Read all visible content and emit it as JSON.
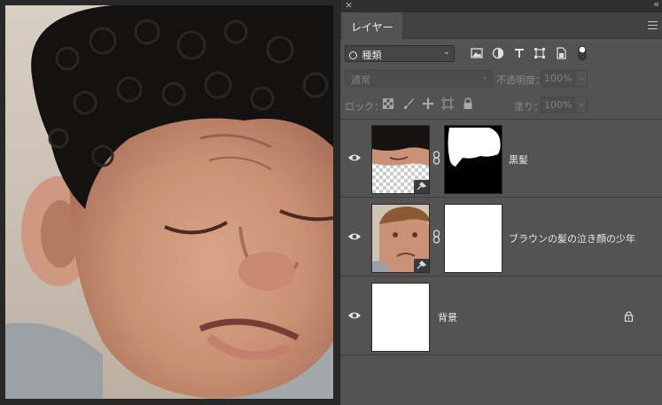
{
  "window": {
    "close_glyph": "×",
    "collapse_glyph": "‹‹"
  },
  "panel": {
    "tab_label": "レイヤー",
    "filter": {
      "kind_label": "種類",
      "caret": "⌄"
    },
    "blend_mode": {
      "value": "通常",
      "opacity_label": "不透明度：",
      "opacity_value": "100%"
    },
    "lock": {
      "label": "ロック：",
      "fill_label": "塗り：",
      "fill_value": "100%"
    }
  },
  "layers": [
    {
      "name": "黒髪",
      "visible": true,
      "smart_object": true,
      "has_mask": true,
      "mask_icon": "chain-link-icon"
    },
    {
      "name": "ブラウンの髪の泣き顔の少年",
      "visible": true,
      "smart_object": true,
      "has_mask": true,
      "mask_icon": "chain-link-icon"
    },
    {
      "name": "背景",
      "visible": true,
      "locked": true,
      "lock_icon": "lock-icon"
    }
  ],
  "icons": {
    "filter_icons": [
      "image-filter-icon",
      "adjustment-filter-icon",
      "type-filter-icon",
      "shape-filter-icon",
      "smartobject-filter-icon",
      "filter-toggle-icon"
    ],
    "lock_icons": [
      "lock-transparent-icon",
      "lock-paint-icon",
      "lock-position-icon",
      "lock-artboard-icon",
      "lock-all-icon"
    ]
  },
  "colors": {
    "panel_bg": "#535353",
    "canvas_bg": "#282828",
    "tab_bar_bg": "#424242",
    "mask_black": "#000000",
    "mask_white": "#ffffff"
  }
}
